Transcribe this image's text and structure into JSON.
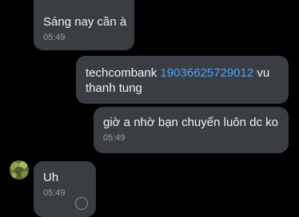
{
  "messages": [
    {
      "text": "Sáng nay cần à",
      "time": "05:49"
    },
    {
      "line1_prefix": "techcombank ",
      "account_number": "19036625729012",
      "line1_suffix": " vu",
      "line2": "thanh tung"
    },
    {
      "text": "giờ a nhờ bạn chuyển luôn dc ko",
      "time": "05:49"
    },
    {
      "text": "Uh",
      "time": "05:49"
    }
  ],
  "colors": {
    "background": "#000000",
    "bubble": "#3a3e43",
    "link": "#4ea3ff",
    "timestamp": "#9aa0a6"
  },
  "icons": [
    "avatar",
    "reaction-icon"
  ]
}
